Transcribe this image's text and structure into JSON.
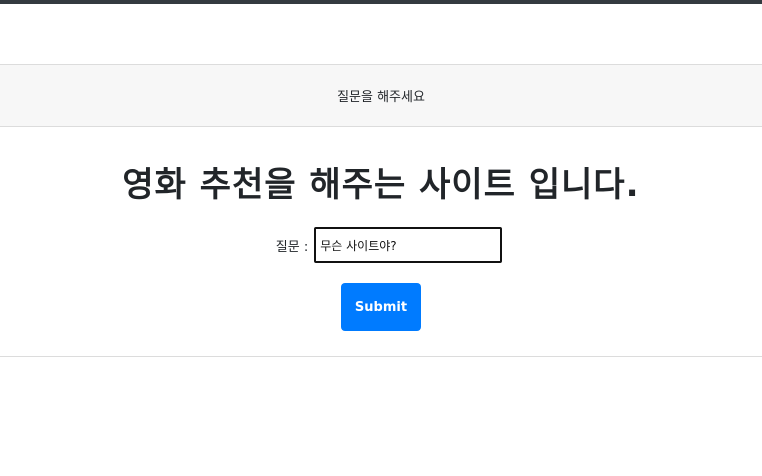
{
  "header": {
    "title": "질문을 해주세요"
  },
  "main": {
    "heading": "영화 추천을 해주는 사이트 입니다.",
    "question_label": "질문 :",
    "question_value": "무슨 사이트야?",
    "submit_label": "Submit"
  },
  "colors": {
    "accent": "#007bff",
    "top_bar": "#343a40",
    "header_bg": "#f7f7f7"
  }
}
